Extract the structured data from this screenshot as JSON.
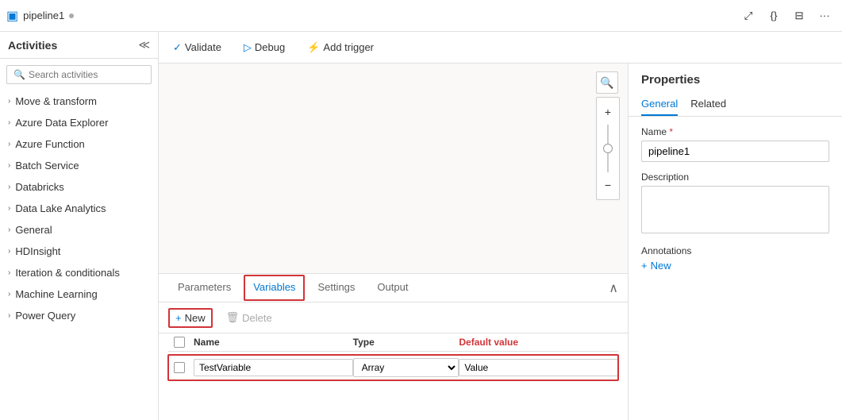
{
  "topbar": {
    "pipeline_icon": "▣",
    "title": "pipeline1",
    "dot": "●"
  },
  "toolbar": {
    "validate_label": "Validate",
    "debug_label": "Debug",
    "add_trigger_label": "Add trigger"
  },
  "sidebar": {
    "title": "Activities",
    "search_placeholder": "Search activities",
    "collapse_icon": "≪",
    "items": [
      {
        "label": "Move & transform"
      },
      {
        "label": "Azure Data Explorer"
      },
      {
        "label": "Azure Function"
      },
      {
        "label": "Batch Service"
      },
      {
        "label": "Databricks"
      },
      {
        "label": "Data Lake Analytics"
      },
      {
        "label": "General"
      },
      {
        "label": "HDInsight"
      },
      {
        "label": "Iteration & conditionals"
      },
      {
        "label": "Machine Learning"
      },
      {
        "label": "Power Query"
      }
    ]
  },
  "bottom_panel": {
    "tabs": [
      {
        "label": "Parameters",
        "active": false
      },
      {
        "label": "Variables",
        "active": true
      },
      {
        "label": "Settings",
        "active": false
      },
      {
        "label": "Output",
        "active": false
      }
    ],
    "new_btn": "New",
    "delete_btn": "Delete",
    "table": {
      "headers": [
        "Name",
        "Type",
        "Default value"
      ],
      "rows": [
        {
          "name": "TestVariable",
          "type": "Array",
          "default": "Value"
        }
      ]
    }
  },
  "right_panel": {
    "title": "Properties",
    "tabs": [
      {
        "label": "General",
        "active": true
      },
      {
        "label": "Related",
        "active": false
      }
    ],
    "fields": {
      "name_label": "Name",
      "name_value": "pipeline1",
      "description_label": "Description",
      "annotations_label": "Annotations",
      "new_annotation": "New"
    }
  }
}
